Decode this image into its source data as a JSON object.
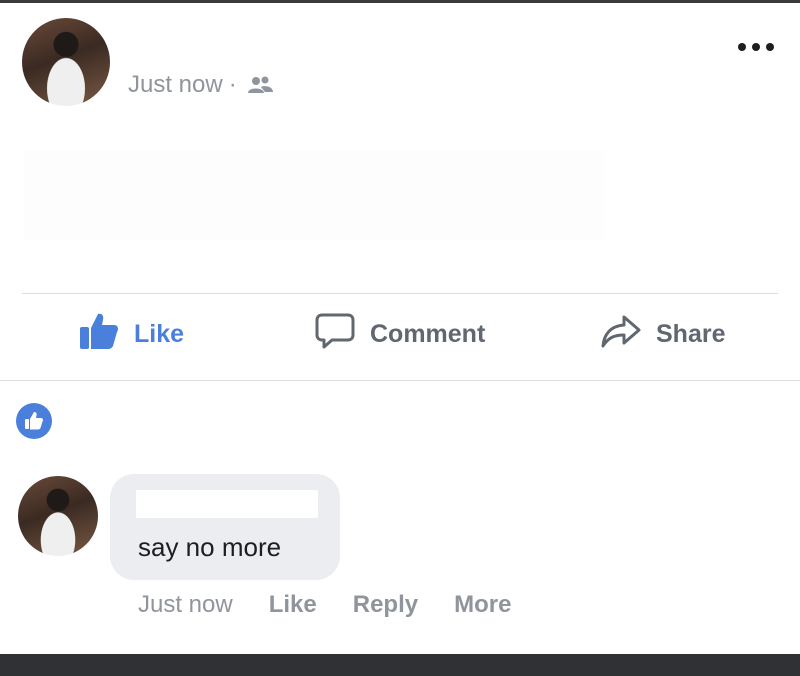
{
  "post": {
    "timestamp": "Just now",
    "separator": "·",
    "audience_icon": "friends-icon"
  },
  "actions": {
    "like_label": "Like",
    "comment_label": "Comment",
    "share_label": "Share"
  },
  "reaction": {
    "icon": "thumbs-up-icon"
  },
  "comment": {
    "text": "say no more",
    "timestamp": "Just now",
    "like_label": "Like",
    "reply_label": "Reply",
    "more_label": "More"
  },
  "colors": {
    "like_blue": "#4a7fdc",
    "muted_text": "#90949c",
    "action_text": "#606770",
    "bubble_bg": "#ebedf0"
  }
}
